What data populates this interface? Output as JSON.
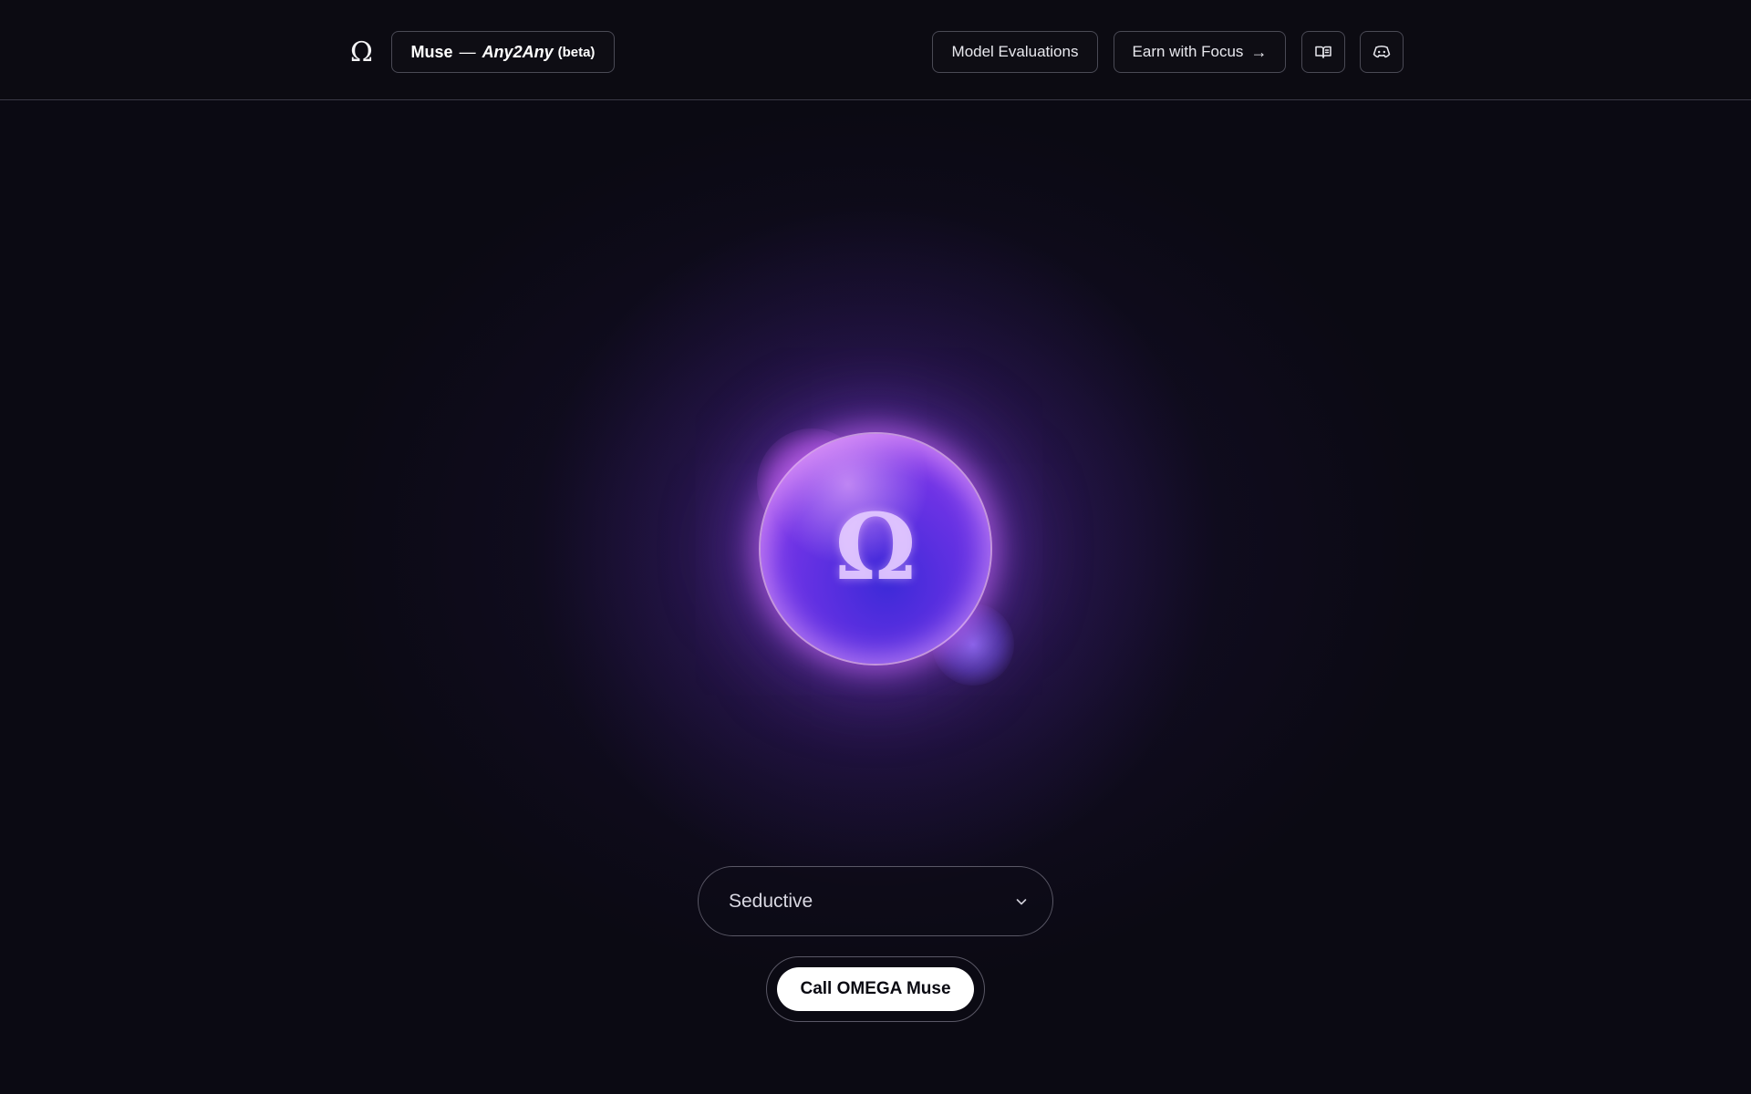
{
  "header": {
    "logo_symbol": "Ω",
    "brand": {
      "name": "Muse",
      "separator": "—",
      "variant": "Any2Any",
      "badge": "(beta)"
    },
    "nav": {
      "model_evaluations": "Model Evaluations",
      "earn_with_focus": "Earn with Focus",
      "earn_arrow": "→",
      "docs_icon": "book-open-icon",
      "discord_icon": "discord-icon"
    }
  },
  "orb": {
    "symbol": "Ω",
    "colors": {
      "glow": "#8c46e6",
      "core": "#4a2ee0",
      "highlight": "#e278ff"
    }
  },
  "controls": {
    "voice_select": {
      "value": "Seductive",
      "icon": "chevron-down-icon"
    },
    "call_button": "Call OMEGA Muse"
  }
}
